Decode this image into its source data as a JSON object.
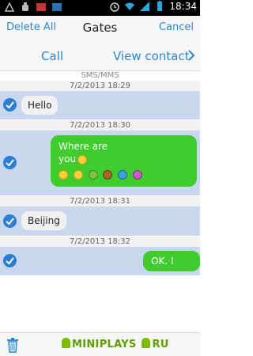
{
  "status_bar": {
    "time": "18:34"
  },
  "header": {
    "left": "Delete All",
    "title": "Gates",
    "right": "Cancel"
  },
  "actions": {
    "call": "Call",
    "view_contact": "View contact"
  },
  "messages": {
    "type_label": "SMS/MMS",
    "items": [
      {
        "timestamp": "7/2/2013 18:29",
        "direction": "in",
        "text": "Hello"
      },
      {
        "timestamp": "7/2/2013 18:30",
        "direction": "out",
        "line1": "Where are",
        "line2": "you"
      },
      {
        "timestamp": "7/2/2013 18:31",
        "direction": "in",
        "text": "Beijing"
      },
      {
        "timestamp": "7/2/2013 18:32",
        "direction": "out",
        "text": "OK. I know"
      }
    ]
  },
  "footer": {
    "watermark_left": "MINIPLAYS",
    "watermark_right": "RU"
  },
  "colors": {
    "accent": "#2a88cf",
    "selected_row": "#c9d8ef",
    "sent_bubble": "#41cc2d",
    "received_bubble": "#f1f1f1"
  },
  "icons": [
    "trash-icon",
    "check-icon",
    "chevron-right-icon",
    "wifi-icon",
    "battery-icon",
    "signal-icon",
    "alarm-icon"
  ]
}
